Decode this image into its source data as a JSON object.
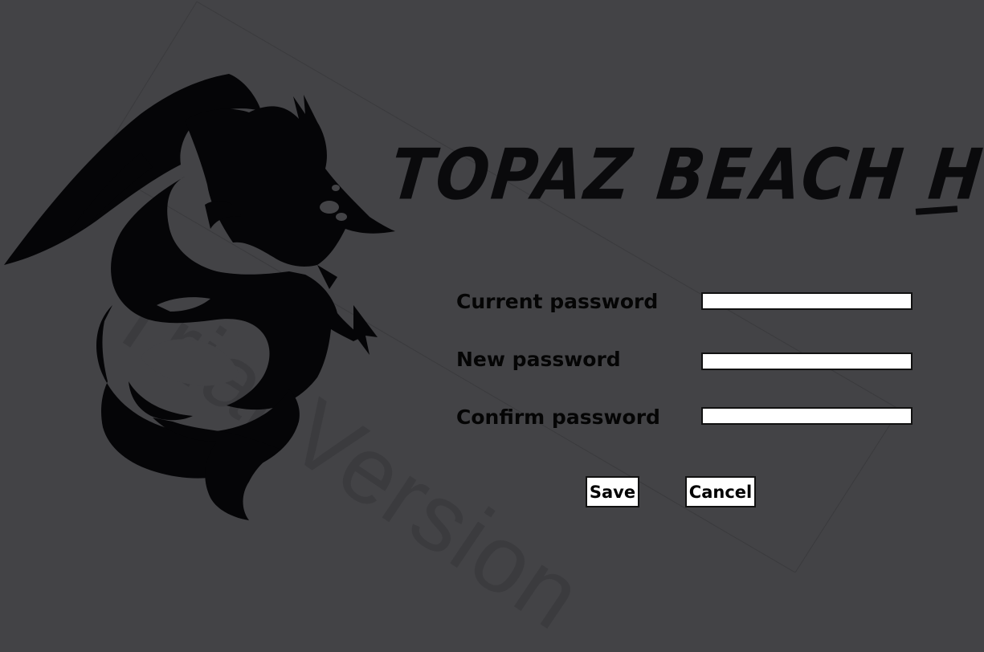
{
  "app": {
    "title": "TOPAZ BEACH HOTEL",
    "watermark": "Trial Version"
  },
  "form": {
    "current_password_label": "Current password",
    "new_password_label": "New password",
    "confirm_password_label": "Confirm password",
    "current_password_value": "",
    "new_password_value": "",
    "confirm_password_value": ""
  },
  "buttons": {
    "save_label": "Save",
    "cancel_label": "Cancel"
  },
  "colors": {
    "background": "#434346",
    "logo": "#0a0a0c",
    "field": "#ffffff"
  },
  "icons": {
    "logo": "dragon-logo-icon"
  }
}
